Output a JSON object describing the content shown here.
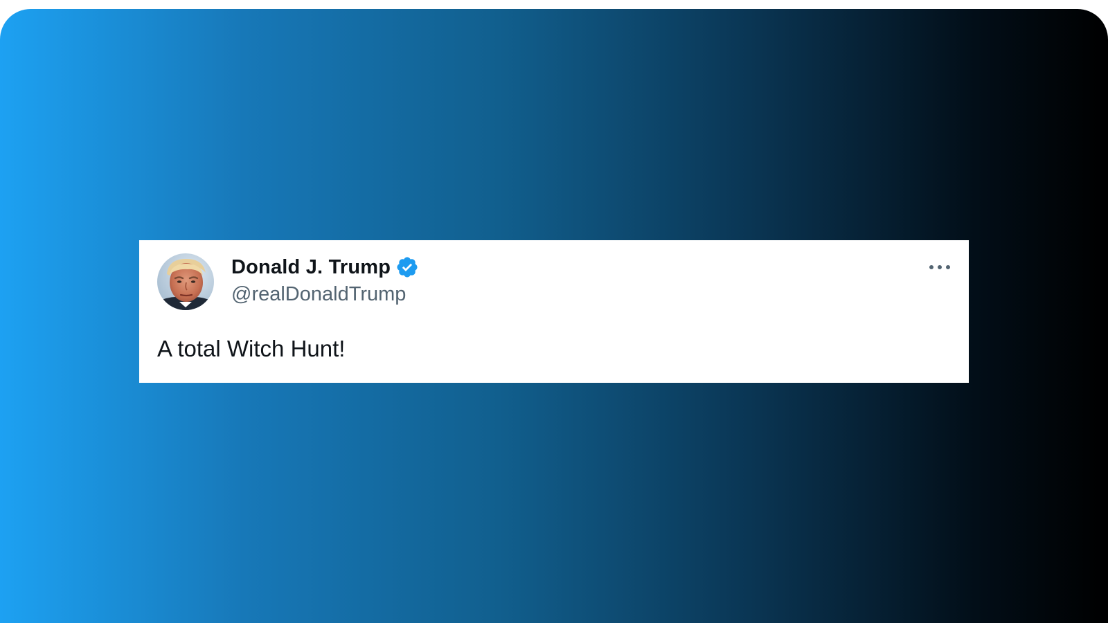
{
  "tweet": {
    "author_name": "Donald J. Trump",
    "author_handle": "@realDonaldTrump",
    "verified": true,
    "text": "A total Witch Hunt!",
    "avatar_icon": "profile-photo",
    "menu_icon": "more-horizontal-icon"
  },
  "colors": {
    "background_gradient_start": "#1da1f2",
    "background_gradient_end": "#000000",
    "card_background": "#ffffff",
    "name_color": "#0f1419",
    "handle_color": "#536471",
    "verified_badge": "#1d9bf0"
  }
}
